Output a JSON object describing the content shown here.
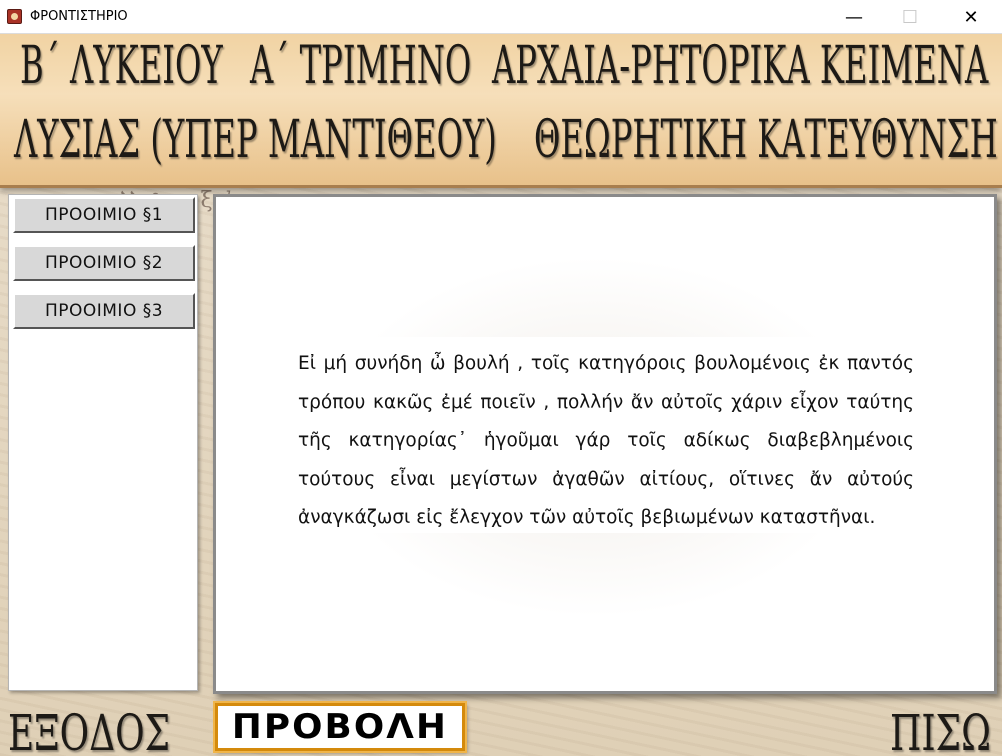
{
  "window": {
    "title": "ΦΡΟΝΤΙΣΤΗΡΙΟ",
    "minimize_glyph": "—",
    "maximize_glyph": "☐",
    "close_glyph": "✕"
  },
  "header": {
    "line1": [
      "Β΄ ΛΥΚΕΙΟΥ",
      "Α΄ ΤΡΙΜΗΝΟ",
      "ΑΡΧΑΙΑ-ΡΗΤΟΡΙΚΑ ΚΕΙΜΕΝΑ"
    ],
    "line2": [
      "ΛΥΣΙΑΣ (ΥΠΕΡ ΜΑΝΤΙΘΕΟΥ)",
      "ΘΕΩΡΗΤΙΚΗ ΚΑΤΕΥΘΥΝΣΗ"
    ]
  },
  "sidebar": {
    "items": [
      {
        "label": "ΠΡΟΟΙΜΙΟ §1"
      },
      {
        "label": "ΠΡΟΟΙΜΙΟ §2"
      },
      {
        "label": "ΠΡΟΟΙΜΙΟ §3"
      }
    ]
  },
  "main": {
    "text": "Εἰ μή συνήδη ὦ βουλή , τοῖς κατηγόροις βουλομένοις ἐκ παντός τρόπου κακῶς ἐμέ ποιεῖν , πολλήν ἄν αὐτοῖς χάριν εἶχον ταύτης τῆς κατηγορίας᾽ ἡγοῦμαι γάρ τοῖς αδίκως διαβεβλημένοις τούτους εἶναι μεγίστων ἀγαθῶν αἰτίους, οἵτινες ἄν αὐτούς ἀναγκάζωσι εἰς ἔλεγχον τῶν αὐτοῖς βεβιωμένων καταστῆναι."
  },
  "footer": {
    "exit_label": "ΕΞΟΔΟΣ",
    "show_label": "ΠΡΟΒΟΛΗ",
    "back_label": "ΠΙΣΩ"
  },
  "colors": {
    "banner": "#f1d3a3",
    "show_border": "#d48a0c",
    "button_face": "#d8d8d8"
  }
}
